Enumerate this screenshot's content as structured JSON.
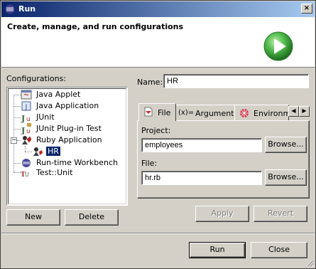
{
  "window": {
    "title": "Run",
    "close_glyph": "×"
  },
  "banner": {
    "title": "Create, manage, and run configurations",
    "icon": "run-icon",
    "accent": "#3a9a3a"
  },
  "configurations": {
    "label": "Configurations:",
    "items": [
      {
        "label": "Java Applet",
        "icon": "java-applet-icon",
        "level": 0
      },
      {
        "label": "Java Application",
        "icon": "java-application-icon",
        "level": 0
      },
      {
        "label": "JUnit",
        "icon": "junit-icon",
        "level": 0
      },
      {
        "label": "JUnit Plug-in Test",
        "icon": "junit-plugin-icon",
        "level": 0
      },
      {
        "label": "Ruby Application",
        "icon": "ruby-icon",
        "level": 0,
        "expanded": true,
        "expander": "−"
      },
      {
        "label": "HR",
        "icon": "ruby-config-icon",
        "level": 1,
        "selected": true
      },
      {
        "label": "Run-time Workbench",
        "icon": "workbench-icon",
        "level": 0
      },
      {
        "label": "Test::Unit",
        "icon": "testunit-icon",
        "level": 0
      }
    ]
  },
  "buttons": {
    "new": "New",
    "delete": "Delete",
    "apply": "Apply",
    "revert": "Revert",
    "run": "Run",
    "close": "Close",
    "browse": "Browse..."
  },
  "form": {
    "name_label": "Name:",
    "name_value": "HR",
    "project_label": "Project:",
    "project_value": "employees",
    "file_label": "File:",
    "file_value": "hr.rb"
  },
  "tabs": [
    {
      "label": "File",
      "icon": "file-icon",
      "active": true
    },
    {
      "label": "Arguments",
      "icon": "arguments-icon",
      "prefix": "(x)="
    },
    {
      "label": "Environment",
      "icon": "environment-icon"
    }
  ],
  "tab_scroll": {
    "left": "◀",
    "right": "▶"
  }
}
